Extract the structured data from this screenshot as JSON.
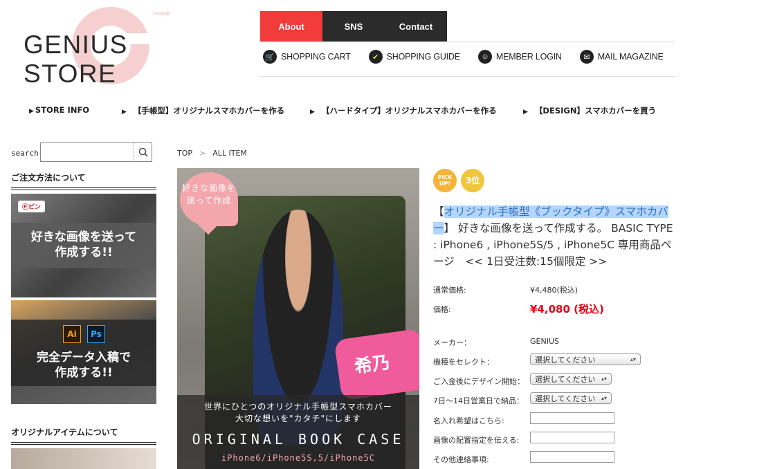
{
  "logo": {
    "text": "GENIUS STORE",
    "small": "mobile"
  },
  "tabs": [
    {
      "label": "About",
      "active": true
    },
    {
      "label": "SNS",
      "active": false
    },
    {
      "label": "Contact",
      "active": false
    }
  ],
  "utility": [
    {
      "label": "SHOPPING CART",
      "icon": "cart-icon"
    },
    {
      "label": "SHOPPING GUIDE",
      "icon": "guide-icon"
    },
    {
      "label": "MEMBER LOGIN",
      "icon": "member-icon"
    },
    {
      "label": "MAIL MAGAZINE",
      "icon": "mail-icon"
    }
  ],
  "catnav": [
    "STORE INFO",
    "【手帳型】オリジナルスマホカバーを作る",
    "【ハードタイプ】オリジナルスマホカバーを作る",
    "【DESIGN】スマホカバーを買う"
  ],
  "search": {
    "label": "search",
    "placeholder": ""
  },
  "sidebar": {
    "heading1": "ご注文方法について",
    "banner1": {
      "pin": "ピン",
      "line1": "好きな画像を送って",
      "line2": "作成する!!"
    },
    "banner2": {
      "ai": "Ai",
      "ps": "Ps",
      "line1": "完全データ入稿で",
      "line2": "作成する!!"
    },
    "heading2": "オリジナルアイテムについて"
  },
  "breadcrumb": {
    "home": "TOP",
    "sep": ">",
    "current": "ALL ITEM"
  },
  "product_image": {
    "heart1": "好きな画像を",
    "heart2": "送って作成",
    "name": "希乃",
    "cap1": "世界にひとつのオリジナル手帳型スマホカバー",
    "cap2": "大切な想いを\"カタチ\"にします",
    "cap3": "ORIGINAL BOOK CASE",
    "cap4": "iPhone6/iPhone5S,5/iPhone5C"
  },
  "badges": {
    "pickup": "PICK UP!",
    "rank": "3位"
  },
  "product": {
    "title_hl1": "オリジナル手帳型《ブックタイプ》スマホカバ",
    "title_hl2": "ー",
    "title_rest1": "】 好きな画像を送って作成する。 BASIC TYPE",
    "title_rest2": ": iPhone6 , iPhone5S/5 , iPhone5C 専用商品ペ",
    "title_rest3": "ージ　<< 1日受注数:15個限定 >>",
    "title_open": "【",
    "regular_label": "通常価格:",
    "regular_value": "¥4,480(税込)",
    "price_label": "価格:",
    "price_value": "¥4,080 (税込)",
    "maker_label": "メーカー：",
    "maker_value": "GENIUS",
    "options": [
      {
        "label": "機種をセレクト：",
        "value": "選択してください"
      },
      {
        "label": "ご入金後にデザイン開始：",
        "value": "選択してください"
      },
      {
        "label": "7日〜14日営業日で納品：",
        "value": "選択してください"
      }
    ],
    "fields": [
      {
        "label": "名入れ希望はこちら:",
        "value": ""
      },
      {
        "label": "画像の配置指定を伝える:",
        "value": ""
      },
      {
        "label": "その他連絡事項:",
        "value": ""
      }
    ]
  }
}
